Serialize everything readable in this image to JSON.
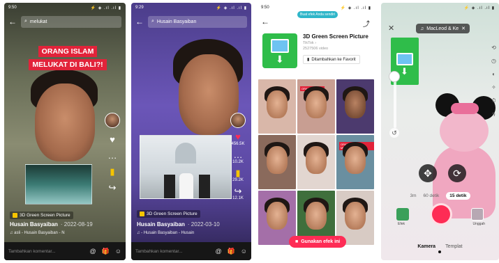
{
  "screen1": {
    "status_time": "9:50",
    "status_icons": "⚡ ◈ .ıl .ıl ▮",
    "search_value": "melukat",
    "caption_lines": [
      "ORANG ISLAM",
      "MELUKAT DI BALI?!"
    ],
    "effect_label": "3D Green Screen Picture",
    "author": "Husain Basyaiban",
    "date": "· 2022-08-19",
    "music": "♫ asli - Husain Basyaiban - N",
    "comment_placeholder": "Tambahkan komentar...",
    "icons": {
      "at": "@",
      "gift": "🎁",
      "emoji": "☺"
    },
    "rail": [
      "♥",
      "…",
      "▮",
      "↪"
    ]
  },
  "screen2": {
    "status_time": "9:29",
    "status_icons": "⚡ ◈ .ıl .ıl ▮",
    "search_value": "Husain Basyaiban",
    "effect_label": "3D Green Screen Picture",
    "author": "Husain Basyaiban",
    "date": "· 2022-03-10",
    "music": "♫ - Husain Basyaiban - Husain",
    "comment_placeholder": "Tambahkan komentar...",
    "rail": [
      {
        "icon": "♥",
        "count": "456.5K"
      },
      {
        "icon": "…",
        "count": "10.2K"
      },
      {
        "icon": "▮",
        "count": "29.2K"
      },
      {
        "icon": "↪",
        "count": "12.1K"
      }
    ]
  },
  "screen3": {
    "status_time": "9:50",
    "try_pill": "Buat efek Anda sendiri",
    "effect_title": "3D Green Screen Picture",
    "effect_author": "TikTok ›",
    "effect_count": "2527506 video",
    "fav_label": "Ditambahkan ke Favorit",
    "use_effect_label": "Gunakan efek ini",
    "cell_labels": [
      "ORANG ISLAM...",
      "ORANG ISLAM MELUKAT DI BALI?!"
    ]
  },
  "screen4": {
    "music_chip": "MacLeod & Ke",
    "timer_options": [
      "3m",
      "60 detik",
      "15 detik"
    ],
    "left_label": "Efek",
    "right_label": "Unggah",
    "modes": [
      "Kamera",
      "Templat"
    ],
    "gizmo_move": "✥",
    "gizmo_rotate": "⟳"
  }
}
